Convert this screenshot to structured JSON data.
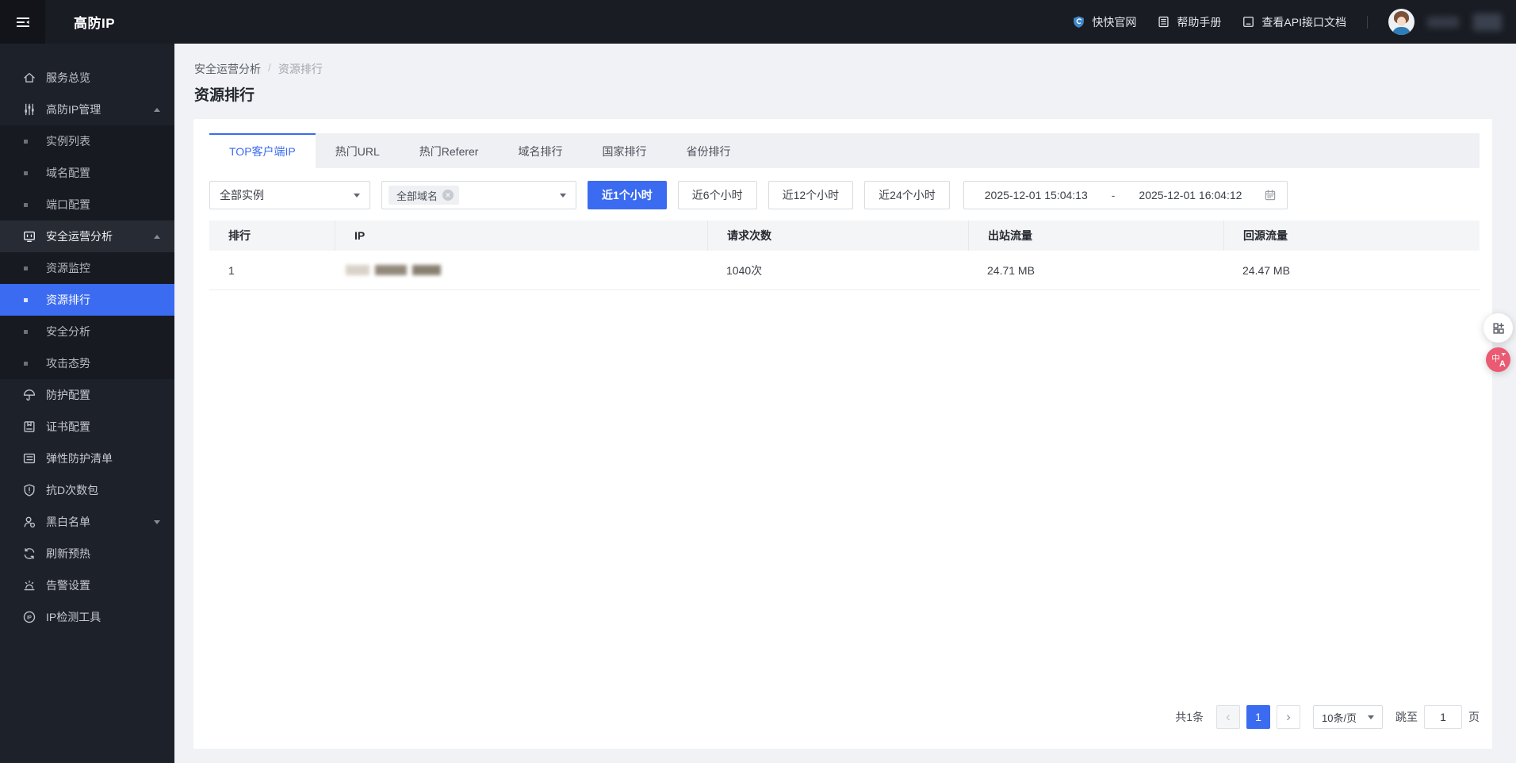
{
  "topbar": {
    "brand": "高防IP",
    "links": [
      {
        "label": "快快官网",
        "icon": "brand-logo-icon"
      },
      {
        "label": "帮助手册",
        "icon": "manual-icon"
      },
      {
        "label": "查看API接口文档",
        "icon": "api-doc-icon"
      }
    ]
  },
  "sidebar": {
    "items": [
      {
        "label": "服务总览",
        "icon": "home-icon",
        "type": "item"
      },
      {
        "label": "高防IP管理",
        "icon": "sliders-icon",
        "type": "group",
        "caret": "up"
      },
      {
        "label": "实例列表",
        "type": "sub"
      },
      {
        "label": "域名配置",
        "type": "sub"
      },
      {
        "label": "端口配置",
        "type": "sub"
      },
      {
        "label": "安全运营分析",
        "icon": "monitor-icon",
        "type": "group",
        "caret": "up",
        "open": true
      },
      {
        "label": "资源监控",
        "type": "sub"
      },
      {
        "label": "资源排行",
        "type": "sub",
        "active": true
      },
      {
        "label": "安全分析",
        "type": "sub"
      },
      {
        "label": "攻击态势",
        "type": "sub"
      },
      {
        "label": "防护配置",
        "icon": "umbrella-icon",
        "type": "item"
      },
      {
        "label": "证书配置",
        "icon": "certificate-icon",
        "type": "item"
      },
      {
        "label": "弹性防护清单",
        "icon": "list-icon",
        "type": "item"
      },
      {
        "label": "抗D次数包",
        "icon": "shield-icon",
        "type": "item"
      },
      {
        "label": "黑白名单",
        "icon": "user-icon",
        "type": "group",
        "caret": "down"
      },
      {
        "label": "刷新预热",
        "icon": "refresh-icon",
        "type": "item"
      },
      {
        "label": "告警设置",
        "icon": "alarm-icon",
        "type": "item"
      },
      {
        "label": "IP检测工具",
        "icon": "ip-tool-icon",
        "type": "item"
      }
    ]
  },
  "breadcrumb": {
    "parent": "安全运营分析",
    "separator": "/",
    "current": "资源排行"
  },
  "page_title": "资源排行",
  "tabs": [
    {
      "label": "TOP客户端IP",
      "active": true
    },
    {
      "label": "热门URL"
    },
    {
      "label": "热门Referer"
    },
    {
      "label": "域名排行"
    },
    {
      "label": "国家排行"
    },
    {
      "label": "省份排行"
    }
  ],
  "filters": {
    "instance_selected": "全部实例",
    "domain_tag": "全部域名",
    "time_ranges": [
      {
        "label": "近1个小时",
        "active": true
      },
      {
        "label": "近6个小时"
      },
      {
        "label": "近12个小时"
      },
      {
        "label": "近24个小时"
      }
    ],
    "date_start": "2025-12-01 15:04:13",
    "date_separator": "-",
    "date_end": "2025-12-01 16:04:12"
  },
  "table": {
    "columns": [
      "排行",
      "IP",
      "请求次数",
      "出站流量",
      "回源流量"
    ],
    "rows": [
      {
        "rank": "1",
        "ip_redacted": true,
        "requests": "1040次",
        "outbound_traffic": "24.71 MB",
        "origin_traffic": "24.47 MB"
      }
    ]
  },
  "pagination": {
    "total": "共1条",
    "current_page": "1",
    "page_size": "10条/页",
    "jump_label": "跳至",
    "jump_value": "1",
    "page_suffix": "页"
  },
  "colors": {
    "accent_blue": "#3b6bf0",
    "topbar_bg": "#191c23",
    "sidebar_bg": "#1d212a",
    "translate_pink": "#ea5a72"
  }
}
